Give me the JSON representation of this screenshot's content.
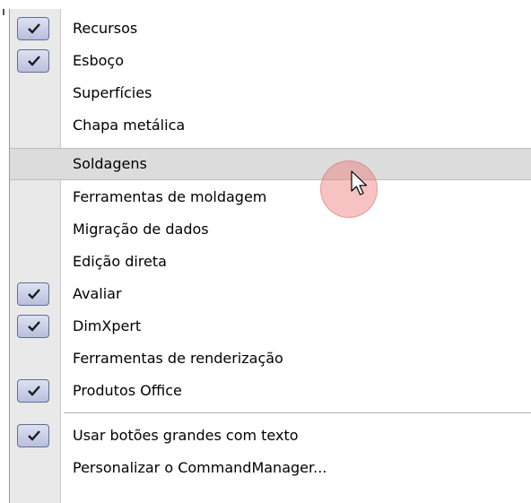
{
  "menu": {
    "items": [
      {
        "label": "Recursos",
        "checked": true
      },
      {
        "label": "Esboço",
        "checked": true
      },
      {
        "label": "Superfícies",
        "checked": false
      },
      {
        "label": "Chapa metálica",
        "checked": false
      },
      {
        "label": "Soldagens",
        "checked": false,
        "highlighted": true
      },
      {
        "label": "Ferramentas de moldagem",
        "checked": false
      },
      {
        "label": "Migração de dados",
        "checked": false
      },
      {
        "label": "Edição direta",
        "checked": false
      },
      {
        "label": "Avaliar",
        "checked": true
      },
      {
        "label": "DimXpert",
        "checked": true
      },
      {
        "label": "Ferramentas de renderização",
        "checked": false
      },
      {
        "label": "Produtos Office",
        "checked": true
      },
      {
        "label": "Usar botões grandes com texto",
        "checked": true
      },
      {
        "label": "Personalizar o CommandManager...",
        "checked": false
      }
    ]
  },
  "colors": {
    "gutter": "#e9e9e9",
    "highlight": "#dcdcdc",
    "check_box": "#c9cde6",
    "cursor_ring": "#eb7878"
  },
  "icons": {
    "check": "checkmark-icon",
    "cursor": "mouse-pointer-icon"
  }
}
